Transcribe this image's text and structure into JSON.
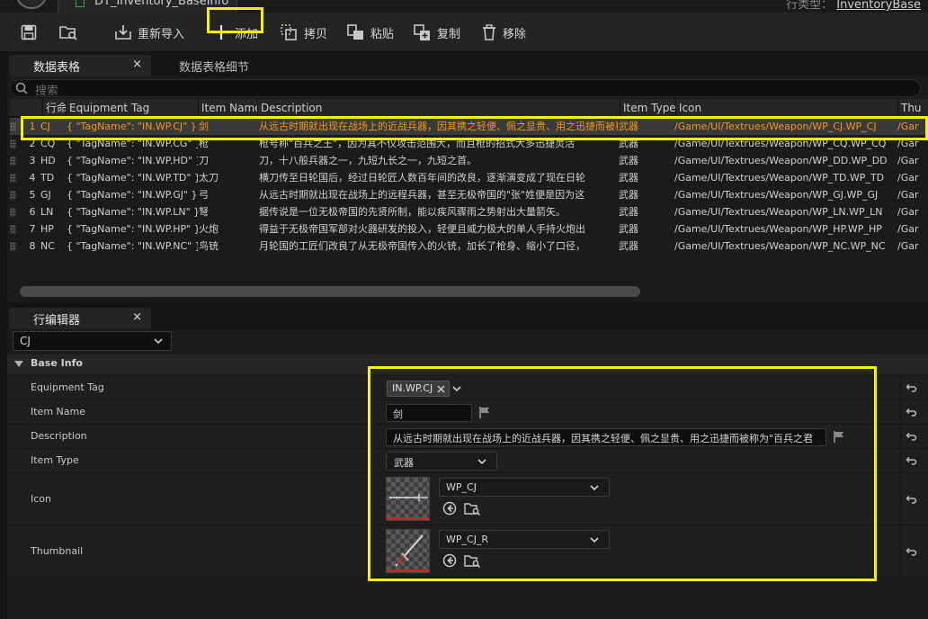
{
  "window": {
    "doc_tab_title": "DT_Inventory_BaseInfo",
    "row_type_label": "行类型：",
    "row_type_value": "InventoryBase"
  },
  "toolbar": {
    "save_icon": "save-icon",
    "browse_icon": "browse-icon",
    "reimport_label": "重新导入",
    "add_label": "添加",
    "copy_label": "拷贝",
    "paste_label": "粘贴",
    "duplicate_label": "复制",
    "remove_label": "移除"
  },
  "datatable": {
    "tab_label": "数据表格",
    "details_tab_label": "数据表格细节",
    "close_glyph": "×",
    "search_placeholder": "搜索",
    "columns": [
      "",
      "行命名",
      "Equipment Tag",
      "Item Name",
      "Description",
      "Item Type",
      "Icon",
      "Thu"
    ],
    "selected_row_index": 0,
    "rows": [
      {
        "num": "1",
        "name": "CJ",
        "tag": "{ \"TagName\": \"IN.WP.CJ\" }",
        "item_name": "剑",
        "desc": "从远古时期就出现在战场上的近战兵器，因其携之轻便、佩之显贵、用之迅捷而被称为\"百兵之君\"",
        "type": "武器",
        "icon": "/Game/UI/Textrues/Weapon/WP_CJ.WP_CJ",
        "thumb": "/Gar"
      },
      {
        "num": "2",
        "name": "CQ",
        "tag": "{ \"TagName\": \"IN.WP.CG\" }",
        "item_name": "枪",
        "desc": "枪号称\"百兵之王\"，因为其不仅攻击范围大，而且枪的招式大多迅捷灵活",
        "type": "武器",
        "icon": "/Game/UI/Textrues/Weapon/WP_CQ.WP_CQ",
        "thumb": "/Gar"
      },
      {
        "num": "3",
        "name": "HD",
        "tag": "{ \"TagName\": \"IN.WP.HD\" }",
        "item_name": "刀",
        "desc": "刀，十八般兵器之一，九短九长之一，九短之首。",
        "type": "武器",
        "icon": "/Game/UI/Textrues/Weapon/WP_DD.WP_DD",
        "thumb": "/Gar"
      },
      {
        "num": "4",
        "name": "TD",
        "tag": "{ \"TagName\": \"IN.WP.TD\" }",
        "item_name": "太刀",
        "desc": "横刀传至日轮国后，经过日轮匠人数百年间的改良，逐渐演变成了现在日轮",
        "type": "武器",
        "icon": "/Game/UI/Textrues/Weapon/WP_TD.WP_TD",
        "thumb": "/Gar"
      },
      {
        "num": "5",
        "name": "GJ",
        "tag": "{ \"TagName\": \"IN.WP.GJ\" }",
        "item_name": "弓",
        "desc": "从远古时期就出现在战场上的远程兵器，甚至无极帝国的\"张\"姓便是因为这",
        "type": "武器",
        "icon": "/Game/UI/Textrues/Weapon/WP_GJ.WP_GJ",
        "thumb": "/Gar"
      },
      {
        "num": "6",
        "name": "LN",
        "tag": "{ \"TagName\": \"IN.WP.LN\" }",
        "item_name": "弩",
        "desc": "据传说是一位无极帝国的先贤所制，能以疾风骤雨之势射出大量箭矢。",
        "type": "武器",
        "icon": "/Game/UI/Textrues/Weapon/WP_LN.WP_LN",
        "thumb": "/Gar"
      },
      {
        "num": "7",
        "name": "HP",
        "tag": "{ \"TagName\": \"IN.WP.HP\" }",
        "item_name": "火炮",
        "desc": "得益于无极帝国军部对火器研发的投入，轻便且威力极大的单人手持火炮出",
        "type": "武器",
        "icon": "/Game/UI/Textrues/Weapon/WP_HP.WP_HP",
        "thumb": "/Gar"
      },
      {
        "num": "8",
        "name": "NC",
        "tag": "{ \"TagName\": \"IN.WP.NC\" }",
        "item_name": "鸟铳",
        "desc": "月轮国的工匠们改良了从无极帝国传入的火铳，加长了枪身、缩小了口径，",
        "type": "武器",
        "icon": "/Game/UI/Textrues/Weapon/WP_NC.WP_NC",
        "thumb": "/Gar"
      }
    ]
  },
  "roweditor": {
    "tab_label": "行编辑器",
    "close_glyph": "×",
    "selected_row": "CJ",
    "section_title": "Base Info",
    "props": {
      "equipment_tag_label": "Equipment Tag",
      "equipment_tag_value": "IN.WP.CJ",
      "item_name_label": "Item Name",
      "item_name_value": "剑",
      "description_label": "Description",
      "description_value": "从远古时期就出现在战场上的近战兵器，因其携之轻便、佩之显贵、用之迅捷而被称为\"百兵之君",
      "item_type_label": "Item Type",
      "item_type_value": "武器",
      "icon_label": "Icon",
      "icon_value": "WP_CJ",
      "thumbnail_label": "Thumbnail",
      "thumbnail_value": "WP_CJ_R"
    }
  },
  "colors": {
    "highlight": "#f5f20a",
    "selected_text": "#f29a1a",
    "panel_bg": "#1b1b1b"
  }
}
